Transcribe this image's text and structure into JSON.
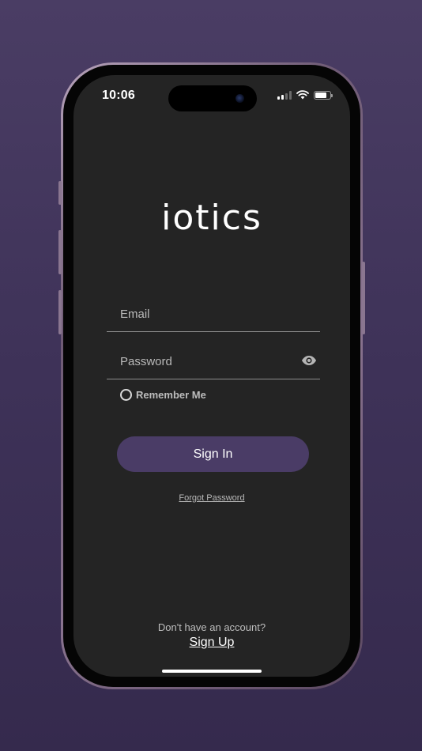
{
  "status_bar": {
    "time": "10:06",
    "battery_level": 0.8,
    "signal_bars_active": 2,
    "signal_bars_total": 4
  },
  "logo": {
    "text": "iotics"
  },
  "form": {
    "email_placeholder": "Email",
    "email_value": "",
    "password_placeholder": "Password",
    "password_value": "",
    "remember_label": "Remember Me",
    "remember_checked": false
  },
  "actions": {
    "sign_in_label": "Sign In",
    "forgot_label": "Forgot Password",
    "no_account_text": "Don't have an account?",
    "sign_up_label": "Sign Up"
  },
  "colors": {
    "background": "#3e3258",
    "screen": "#242424",
    "primary_button": "#4a3c66"
  },
  "icons": {
    "eye": "eye-icon",
    "wifi": "wifi-icon",
    "signal": "signal-icon",
    "battery": "battery-icon"
  }
}
